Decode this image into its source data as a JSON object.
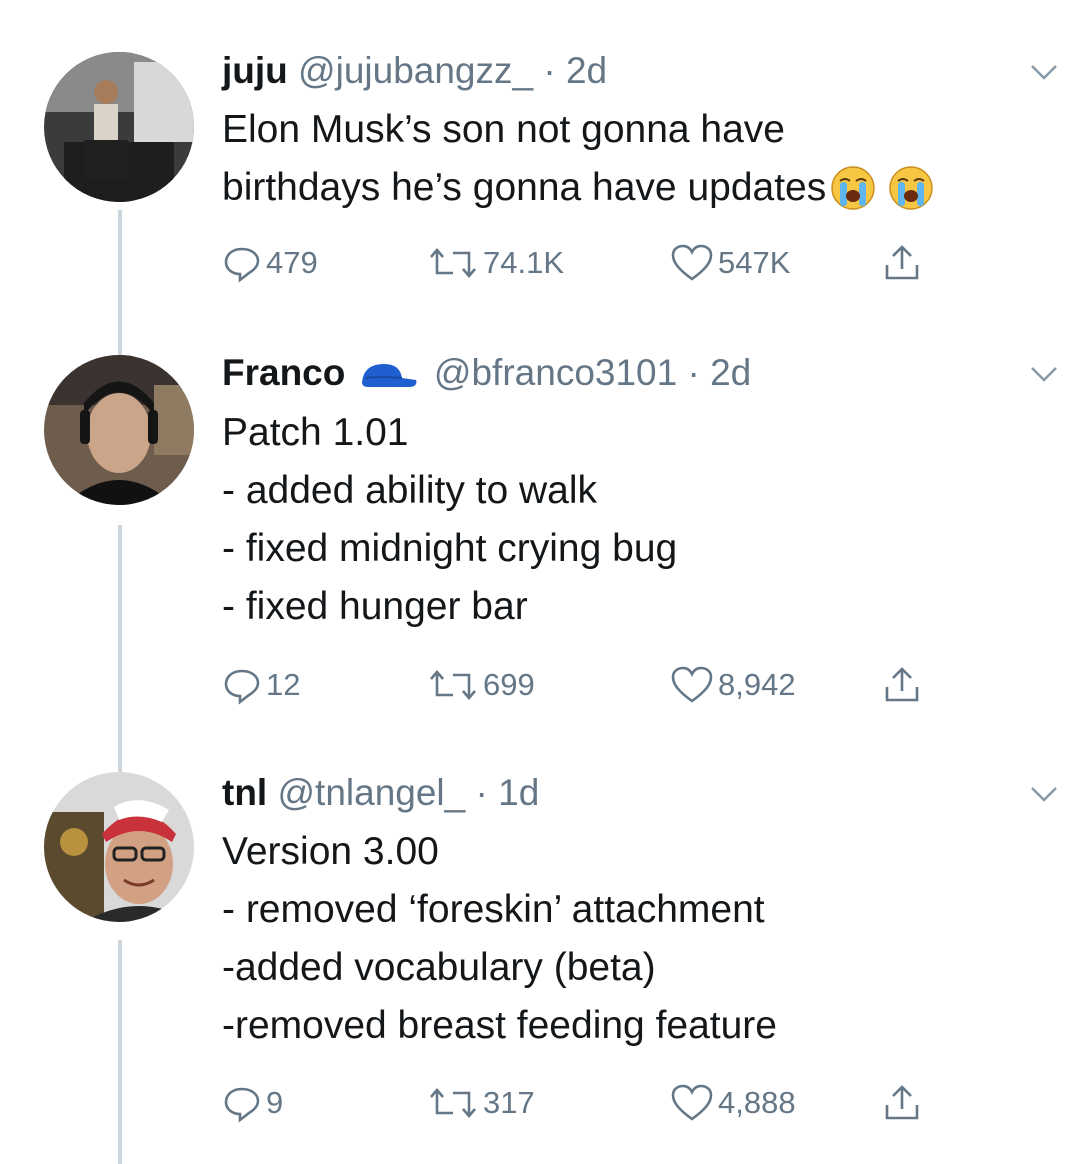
{
  "tweets": [
    {
      "name": "juju",
      "handle": "@jujubangzz_",
      "time": "· 2d",
      "lines": [
        "Elon Musk’s son not gonna have",
        "birthdays he’s gonna have updates"
      ],
      "emoji": [
        "loudly-crying-face",
        "loudly-crying-face"
      ],
      "replies": "479",
      "retweets": "74.1K",
      "likes": "547K"
    },
    {
      "name": "Franco",
      "handle": "@bfranco3101",
      "time": "· 2d",
      "lines": [
        "Patch 1.01",
        "- added ability to walk",
        "- fixed midnight crying bug",
        "- fixed hunger bar"
      ],
      "replies": "12",
      "retweets": "699",
      "likes": "8,942"
    },
    {
      "name": "tnl",
      "handle": "@tnlangel_",
      "time": "· 1d",
      "lines": [
        "Version 3.00",
        "- removed ‘foreskin’ attachment",
        "-added vocabulary (beta)",
        "-removed breast feeding feature"
      ],
      "replies": "9",
      "retweets": "317",
      "likes": "4,888"
    }
  ],
  "colors": {
    "text": "#14171a",
    "meta": "#657786",
    "thread_line": "#ccd6dd",
    "verified_cap": "#1f5fcf"
  }
}
